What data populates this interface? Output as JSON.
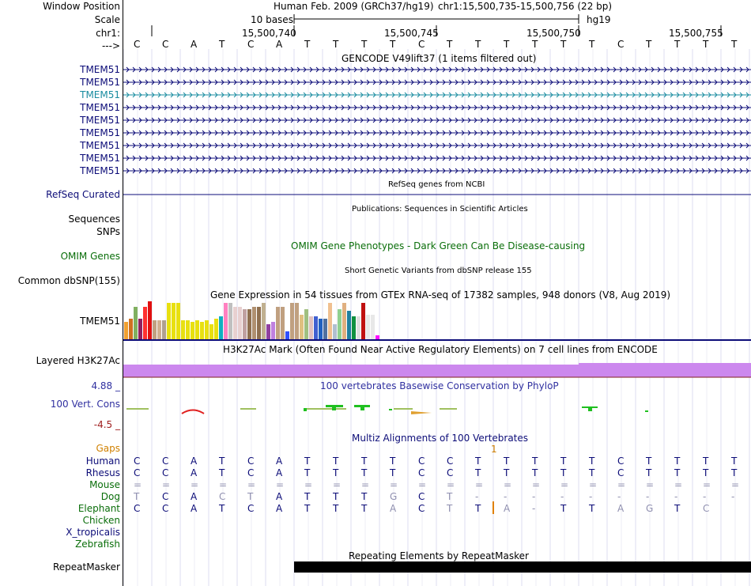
{
  "header": {
    "window_position_label": "Window Position",
    "scale_label": "Scale",
    "chrom_label": "chr1:",
    "strand_label": "--->",
    "assembly_text": "Human Feb. 2009 (GRCh37/hg19)",
    "position_text": "chr1:15,500,735-15,500,756 (22 bp)",
    "scale_text": "10 bases",
    "scale_db": "hg19",
    "ticks": [
      "15,500,740",
      "15,500,745",
      "15,500,750",
      "15,500,755"
    ],
    "bases": [
      "C",
      "C",
      "A",
      "T",
      "C",
      "A",
      "T",
      "T",
      "T",
      "T",
      "C",
      "T",
      "T",
      "T",
      "T",
      "T",
      "T",
      "C",
      "T",
      "T",
      "T",
      "T"
    ]
  },
  "gencode": {
    "title": "GENCODE V49lift37 (1 items filtered out)",
    "rows": [
      "TMEM51",
      "TMEM51",
      "TMEM51",
      "TMEM51",
      "TMEM51",
      "TMEM51",
      "TMEM51",
      "TMEM51",
      "TMEM51"
    ],
    "highlight_row": 2,
    "color": "#0c0c78",
    "highlight_color": "#1a8ca0"
  },
  "refseq": {
    "label": "RefSeq Curated",
    "title": "RefSeq genes from NCBI"
  },
  "publications": {
    "label": "Sequences",
    "title": "Publications: Sequences in Scientific Articles"
  },
  "snps": {
    "label": "SNPs"
  },
  "omim": {
    "label": "OMIM Genes",
    "title": "OMIM Gene Phenotypes - Dark Green Can Be Disease-causing",
    "color": "#0a6e0a"
  },
  "dbsnp": {
    "label": "Common dbSNP(155)",
    "title": "Short Genetic Variants from dbSNP release 155"
  },
  "gtex": {
    "label": "TMEM51",
    "title": "Gene Expression in 54 tissues from GTEx RNA-seq of 17382 samples, 948 donors (V8, Aug 2019)",
    "values": [
      0.45,
      0.55,
      0.85,
      0.55,
      0.85,
      1.0,
      0.5,
      0.5,
      0.5,
      0.95,
      0.95,
      0.95,
      0.5,
      0.5,
      0.45,
      0.5,
      0.45,
      0.5,
      0.4,
      0.55,
      0.6,
      0.95,
      0.95,
      0.85,
      0.85,
      0.8,
      0.8,
      0.85,
      0.85,
      0.95,
      0.4,
      0.45,
      0.85,
      0.85,
      0.2,
      0.95,
      0.95,
      0.65,
      0.8,
      0.6,
      0.6,
      0.55,
      0.55,
      0.95,
      0.4,
      0.8,
      0.95,
      0.75,
      0.6,
      0.6,
      0.95,
      0.65,
      0.65,
      0.1
    ],
    "colors": [
      "#f0a030",
      "#d07020",
      "#80b060",
      "#902060",
      "#ff3030",
      "#e01010",
      "#c0a080",
      "#d0b090",
      "#b0a090",
      "#e8e010",
      "#e8e010",
      "#e8e010",
      "#e8e010",
      "#e8e010",
      "#e8e010",
      "#e8e010",
      "#e8e010",
      "#e8e010",
      "#e8e010",
      "#e8e010",
      "#10b0c0",
      "#ff80c0",
      "#c0c0c0",
      "#e8d0d0",
      "#e8d0d0",
      "#c0a0a0",
      "#907050",
      "#b09070",
      "#907050",
      "#c0b090",
      "#9040a0",
      "#c080e0",
      "#c0a080",
      "#c0a080",
      "#3050ff",
      "#c0a080",
      "#c0a080",
      "#e0c080",
      "#a0c080",
      "#e0c0c0",
      "#4060d0",
      "#2060c0",
      "#5070a0",
      "#f0c090",
      "#b0c0d0",
      "#90d090",
      "#e0b080",
      "#2080a0",
      "#109040",
      "#e0e0e0",
      "#c01010",
      "#e8e8e8",
      "#e8e8e8",
      "#ff10ff"
    ]
  },
  "h3k27ac": {
    "label": "Layered H3K27Ac",
    "title": "H3K27Ac Mark (Often Found Near Active Regulatory Elements) on 7 cell lines from ENCODE",
    "color": "#cc88ee"
  },
  "cons": {
    "label": "100 Vert. Cons",
    "max_label": "4.88 _",
    "min_label": "-4.5 _",
    "title": "100 vertebrates Basewise Conservation by PhyloP",
    "title_color": "#3030a0"
  },
  "multiz": {
    "title": "Multiz Alignments of 100 Vertebrates",
    "title_color": "#0c0c78",
    "gaps_label": "Gaps",
    "gap_mark": "1",
    "species": [
      {
        "name": "Human",
        "color": "#0c0c78",
        "bases": [
          "C",
          "C",
          "A",
          "T",
          "C",
          "A",
          "T",
          "T",
          "T",
          "T",
          "C",
          "C",
          "T",
          "T",
          "T",
          "T",
          "T",
          "C",
          "T",
          "T",
          "T",
          "T"
        ]
      },
      {
        "name": "Rhesus",
        "color": "#0c0c78",
        "bases": [
          "C",
          "C",
          "A",
          "T",
          "C",
          "A",
          "T",
          "T",
          "T",
          "T",
          "C",
          "C",
          "T",
          "T",
          "T",
          "T",
          "T",
          "C",
          "T",
          "T",
          "T",
          "T"
        ]
      },
      {
        "name": "Mouse",
        "color": "#0a6e0a",
        "bases": [
          "=",
          "=",
          "=",
          "=",
          "=",
          "=",
          "=",
          "=",
          "=",
          "=",
          "=",
          "=",
          "=",
          "=",
          "=",
          "=",
          "=",
          "=",
          "=",
          "=",
          "=",
          "="
        ]
      },
      {
        "name": "Dog",
        "color": "#0a6e0a",
        "bases": [
          "T",
          "C",
          "A",
          "C",
          "T",
          "A",
          "T",
          "T",
          "T",
          "G",
          "C",
          "T",
          "-",
          "-",
          "-",
          "-",
          "-",
          "-",
          "-",
          "-",
          "-",
          "-"
        ]
      },
      {
        "name": "Elephant",
        "color": "#0a6e0a",
        "bases": [
          "C",
          "C",
          "A",
          "T",
          "C",
          "A",
          "T",
          "T",
          "T",
          "A",
          "C",
          "T",
          "T",
          "A",
          "-",
          "T",
          "T",
          "A",
          "G",
          "T",
          "C",
          ""
        ]
      },
      {
        "name": "Chicken",
        "color": "#0a6e0a",
        "bases": []
      },
      {
        "name": "X_tropicalis",
        "color": "#0c0c78",
        "bases": []
      },
      {
        "name": "Zebrafish",
        "color": "#0a6e0a",
        "bases": []
      }
    ]
  },
  "repeatmasker": {
    "label": "RepeatMasker",
    "title": "Repeating Elements by RepeatMasker"
  }
}
